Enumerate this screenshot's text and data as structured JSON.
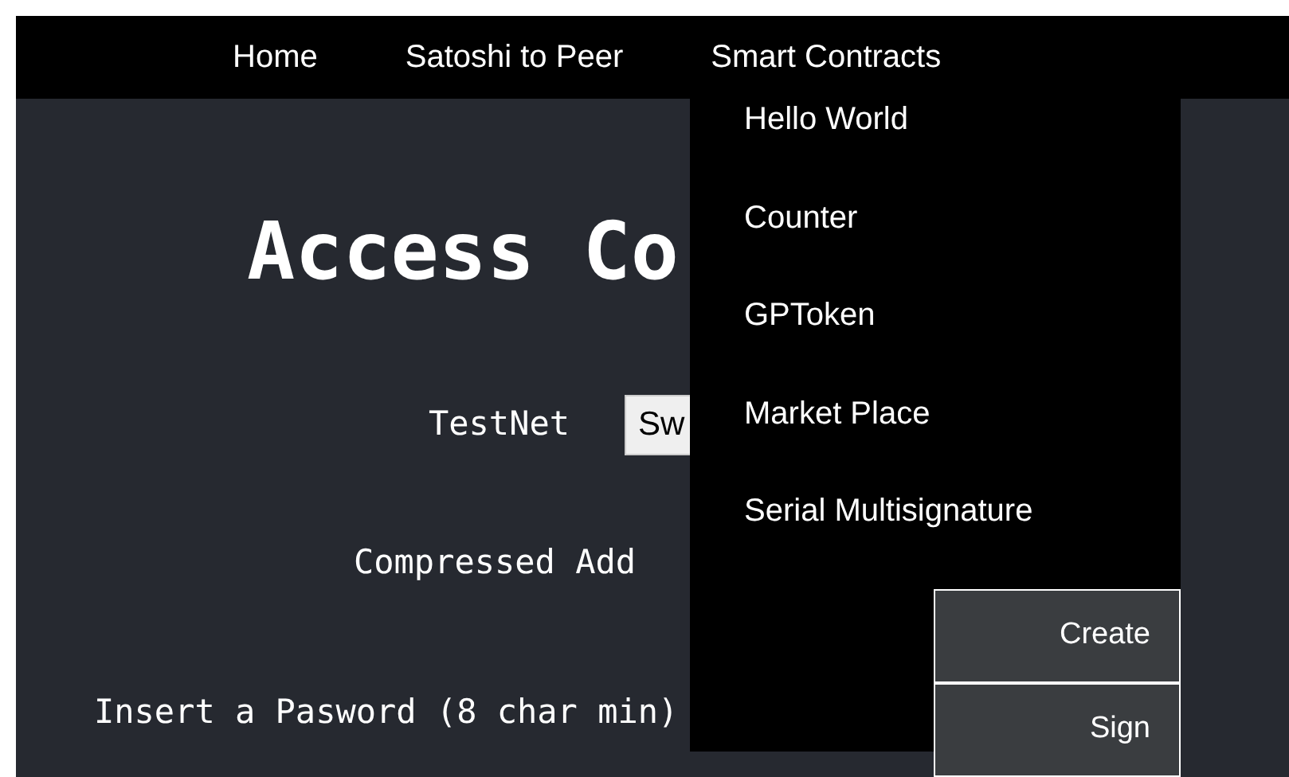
{
  "navbar": {
    "links": [
      "Home",
      "Satoshi to Peer",
      "Smart Contracts"
    ]
  },
  "dropdown": {
    "items": [
      "Hello World",
      "Counter",
      "GPToken",
      "Market Place",
      "Serial Multisignature"
    ],
    "submenu": [
      "Create",
      "Sign"
    ]
  },
  "main": {
    "heading": "Access Co",
    "network_label": "TestNet",
    "network_button": "Sw",
    "address_label": "Compressed Add",
    "password_label": "Insert a Pasword (8 char min)"
  }
}
